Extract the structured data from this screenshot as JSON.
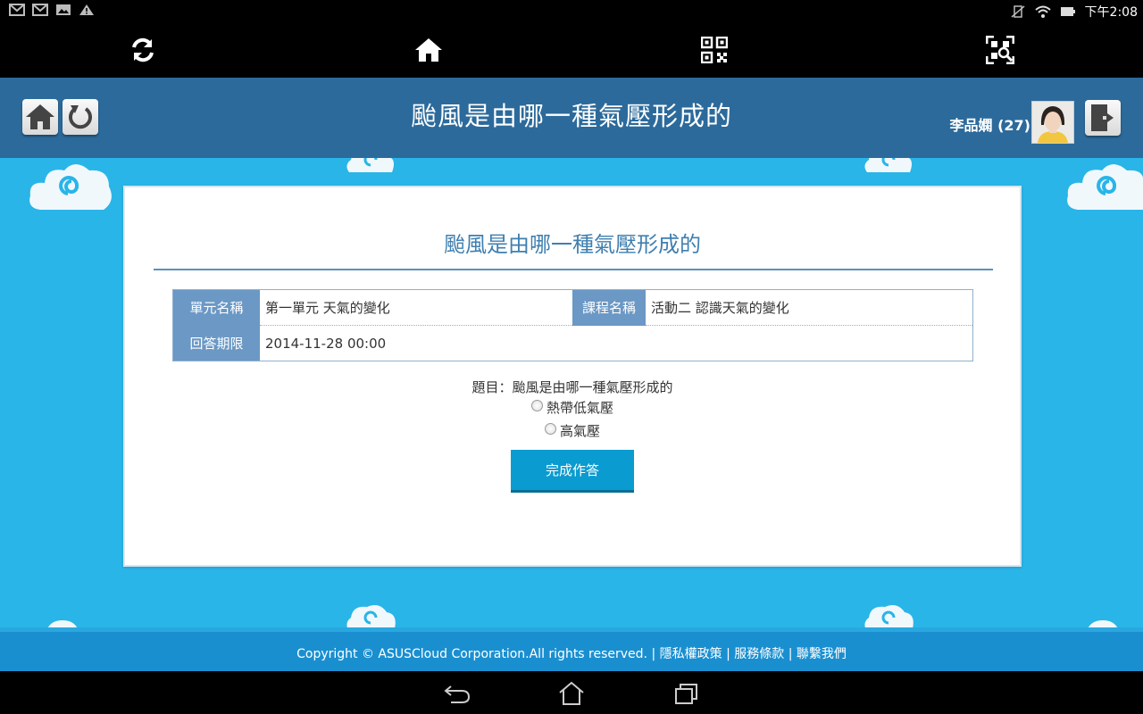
{
  "status_bar": {
    "left_icons": [
      "gmail-icon",
      "gmail-icon",
      "image-icon",
      "warning-icon"
    ],
    "right_icons": [
      "vibrate-off-icon",
      "wifi-icon",
      "battery-icon"
    ],
    "time": "下午2:08"
  },
  "toolbar": {
    "buttons": [
      "refresh-icon",
      "home-icon",
      "qr-code-icon",
      "qr-scan-icon"
    ]
  },
  "header": {
    "title": "颱風是由哪一種氣壓形成的",
    "user": "李品嫻 (27)"
  },
  "card": {
    "title": "颱風是由哪一種氣壓形成的",
    "info": {
      "unit_label": "單元名稱",
      "unit_value": "第一單元 天氣的變化",
      "course_label": "課程名稱",
      "course_value": "活動二 認識天氣的變化",
      "deadline_label": "回答期限",
      "deadline_value": "2014-11-28 00:00"
    },
    "question": "題目：颱風是由哪一種氣壓形成的",
    "options": [
      "熱帶低氣壓",
      "高氣壓"
    ],
    "submit_label": "完成作答"
  },
  "footer": {
    "copyright": "Copyright © ASUSCloud Corporation.All rights reserved.",
    "links": [
      "隱私權政策",
      "服務條款",
      "聯繫我們"
    ]
  },
  "navbar": {
    "buttons": [
      "back-icon",
      "home-icon",
      "recent-apps-icon"
    ]
  },
  "colors": {
    "header_bg": "#2c6a9b",
    "main_bg": "#29b5e8",
    "accent": "#0a9bd0",
    "label_bg": "#6b98c5"
  }
}
